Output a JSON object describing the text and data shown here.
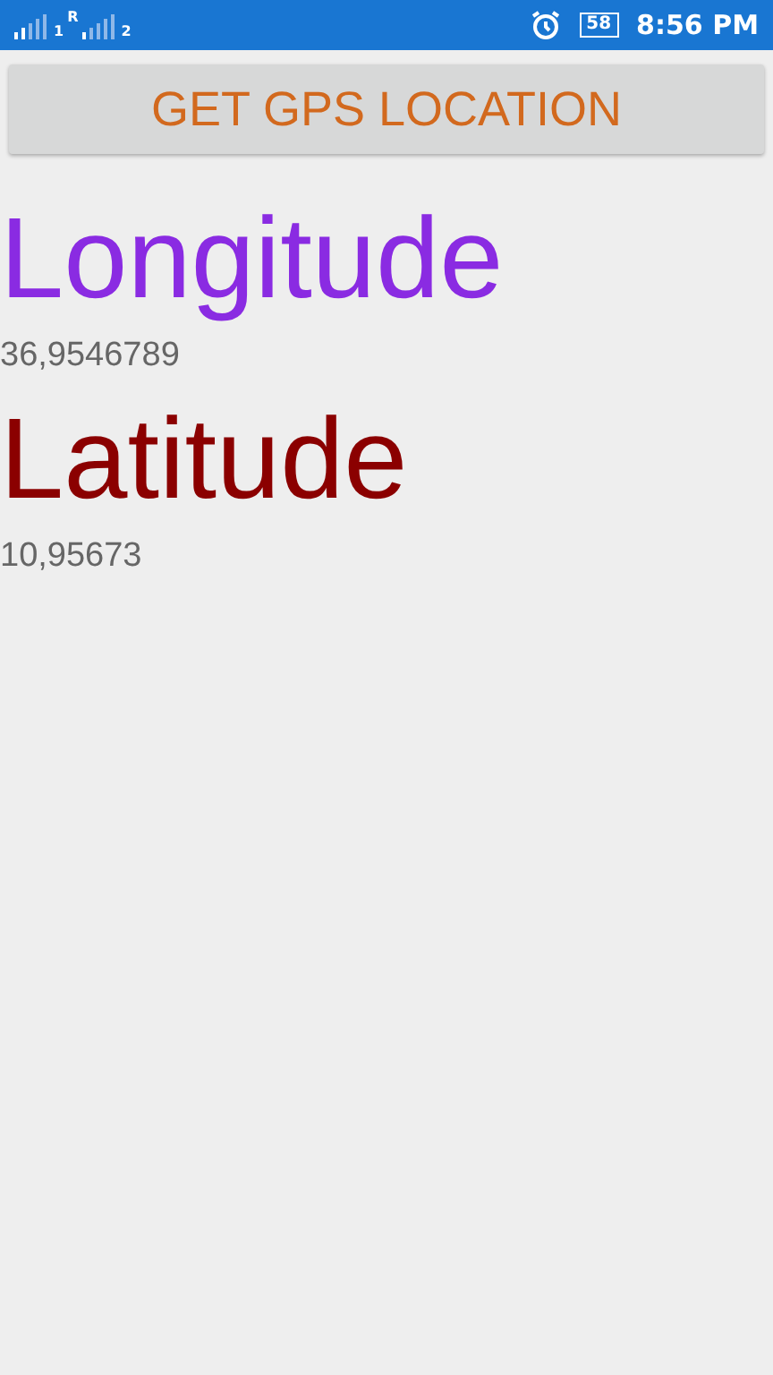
{
  "status_bar": {
    "sim_labels": [
      "1",
      "R",
      "2"
    ],
    "battery": "58",
    "time": "8:56 PM"
  },
  "button": {
    "label": "GET GPS LOCATION"
  },
  "fields": [
    {
      "label": "Longitude",
      "color": "#8a2be2",
      "value": "36,9546789"
    },
    {
      "label": "Latitude",
      "color": "#8b0000",
      "value": "10,95673"
    }
  ]
}
